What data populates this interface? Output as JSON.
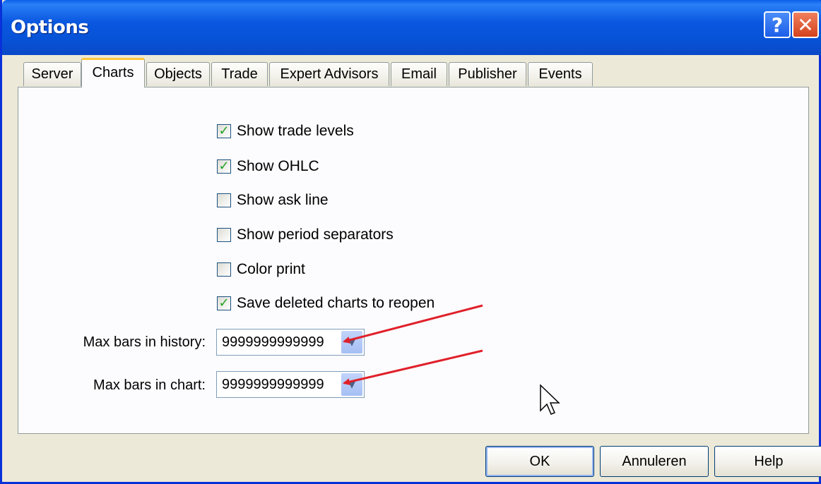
{
  "window": {
    "title": "Options",
    "help_icon": "help-icon",
    "close_icon": "close-icon",
    "help_glyph": "?",
    "close_glyph": "✕"
  },
  "tabs": [
    {
      "label": "Server",
      "active": false
    },
    {
      "label": "Charts",
      "active": true
    },
    {
      "label": "Objects",
      "active": false
    },
    {
      "label": "Trade",
      "active": false
    },
    {
      "label": "Expert Advisors",
      "active": false
    },
    {
      "label": "Email",
      "active": false
    },
    {
      "label": "Publisher",
      "active": false
    },
    {
      "label": "Events",
      "active": false
    }
  ],
  "charts": {
    "checkboxes": [
      {
        "label": "Show trade levels",
        "checked": true
      },
      {
        "label": "Show OHLC",
        "checked": true
      },
      {
        "label": "Show ask line",
        "checked": false
      },
      {
        "label": "Show period separators",
        "checked": false
      },
      {
        "label": "Color print",
        "checked": false
      },
      {
        "label": "Save deleted charts to reopen",
        "checked": true
      }
    ],
    "max_bars_history": {
      "label": "Max bars in history:",
      "value": "9999999999999"
    },
    "max_bars_chart": {
      "label": "Max bars in chart:",
      "value": "9999999999999"
    }
  },
  "buttons": {
    "ok": "OK",
    "cancel": "Annuleren",
    "help": "Help"
  },
  "colors": {
    "title_bar": "#0a57e0",
    "active_tab_accent": "#ffc83c",
    "annotation_arrow": "#e0202a",
    "check_mark": "#21a121"
  }
}
